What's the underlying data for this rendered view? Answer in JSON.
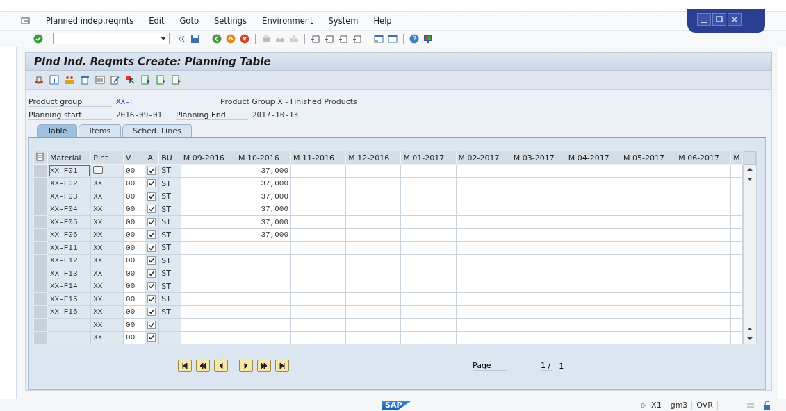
{
  "menu": [
    {
      "label": "Planned indep.reqmts"
    },
    {
      "label": "Edit"
    },
    {
      "label": "Goto"
    },
    {
      "label": "Settings"
    },
    {
      "label": "Environment"
    },
    {
      "label": "System"
    },
    {
      "label": "Help"
    }
  ],
  "title": "Plnd Ind. Reqmts Create: Planning Table",
  "header": {
    "product_group_label": "Product group",
    "product_group": "XX-F",
    "product_group_text": "Product Group X - Finished Products",
    "planning_start_label": "Planning start",
    "planning_start": "2016-09-01",
    "planning_end_label": "Planning End",
    "planning_end": "2017-10-13"
  },
  "tabs": [
    {
      "label": "Table",
      "selected": true
    },
    {
      "label": "Items",
      "selected": false
    },
    {
      "label": "Sched. Lines",
      "selected": false
    }
  ],
  "table": {
    "columns": [
      "Material",
      "Plnt",
      "V",
      "A",
      "BU",
      "M 09-2016",
      "M 10-2016",
      "M 11-2016",
      "M 12-2016",
      "M 01-2017",
      "M 02-2017",
      "M 03-2017",
      "M 04-2017",
      "M 05-2017",
      "M 06-2017",
      "M"
    ],
    "rows": [
      {
        "material": "XX-F01",
        "focused": true,
        "version": "00",
        "active": true,
        "unit": "ST",
        "cells": [
          null,
          "37,000",
          null,
          null,
          null,
          null,
          null,
          null,
          null,
          null,
          null
        ]
      },
      {
        "material": "XX-F02",
        "plant": "XX",
        "focused": false,
        "version": "00",
        "active": true,
        "unit": "ST",
        "cells": [
          null,
          "37,000",
          null,
          null,
          null,
          null,
          null,
          null,
          null,
          null,
          null
        ]
      },
      {
        "material": "XX-F03",
        "plant": "XX",
        "focused": false,
        "version": "00",
        "active": true,
        "unit": "ST",
        "cells": [
          null,
          "37,000",
          null,
          null,
          null,
          null,
          null,
          null,
          null,
          null,
          null
        ]
      },
      {
        "material": "XX-F04",
        "plant": "XX",
        "focused": false,
        "version": "00",
        "active": true,
        "unit": "ST",
        "cells": [
          null,
          "37,000",
          null,
          null,
          null,
          null,
          null,
          null,
          null,
          null,
          null
        ]
      },
      {
        "material": "XX-F05",
        "plant": "XX",
        "focused": false,
        "version": "00",
        "active": true,
        "unit": "ST",
        "cells": [
          null,
          "37,000",
          null,
          null,
          null,
          null,
          null,
          null,
          null,
          null,
          null
        ]
      },
      {
        "material": "XX-F06",
        "plant": "XX",
        "focused": false,
        "version": "00",
        "active": true,
        "unit": "ST",
        "cells": [
          null,
          "37,000",
          null,
          null,
          null,
          null,
          null,
          null,
          null,
          null,
          null
        ]
      },
      {
        "material": "XX-F11",
        "plant": "XX",
        "focused": false,
        "version": "00",
        "active": true,
        "unit": "ST",
        "cells": [
          null,
          null,
          null,
          null,
          null,
          null,
          null,
          null,
          null,
          null,
          null
        ]
      },
      {
        "material": "XX-F12",
        "plant": "XX",
        "focused": false,
        "version": "00",
        "active": true,
        "unit": "ST",
        "cells": [
          null,
          null,
          null,
          null,
          null,
          null,
          null,
          null,
          null,
          null,
          null
        ]
      },
      {
        "material": "XX-F13",
        "plant": "XX",
        "focused": false,
        "version": "00",
        "active": true,
        "unit": "ST",
        "cells": [
          null,
          null,
          null,
          null,
          null,
          null,
          null,
          null,
          null,
          null,
          null
        ]
      },
      {
        "material": "XX-F14",
        "plant": "XX",
        "focused": false,
        "version": "00",
        "active": true,
        "unit": "ST",
        "cells": [
          null,
          null,
          null,
          null,
          null,
          null,
          null,
          null,
          null,
          null,
          null
        ]
      },
      {
        "material": "XX-F15",
        "plant": "XX",
        "focused": false,
        "version": "00",
        "active": true,
        "unit": "ST",
        "cells": [
          null,
          null,
          null,
          null,
          null,
          null,
          null,
          null,
          null,
          null,
          null
        ]
      },
      {
        "material": "XX-F16",
        "plant": "XX",
        "focused": false,
        "version": "00",
        "active": true,
        "unit": "ST",
        "cells": [
          null,
          null,
          null,
          null,
          null,
          null,
          null,
          null,
          null,
          null,
          null
        ]
      },
      {
        "plant": "XX",
        "focused": false,
        "version": "00",
        "active": true,
        "cells": [
          null,
          null,
          null,
          null,
          null,
          null,
          null,
          null,
          null,
          null,
          null
        ]
      },
      {
        "plant": "XX",
        "focused": false,
        "version": "00",
        "active": true,
        "cells": [
          null,
          null,
          null,
          null,
          null,
          null,
          null,
          null,
          null,
          null,
          null
        ]
      }
    ]
  },
  "pager": {
    "page_label": "Page",
    "current": "1 /",
    "total": "1"
  },
  "status_bar": {
    "logo": "SAP",
    "system": "X1",
    "client": "gm3",
    "mode": "OVR"
  }
}
